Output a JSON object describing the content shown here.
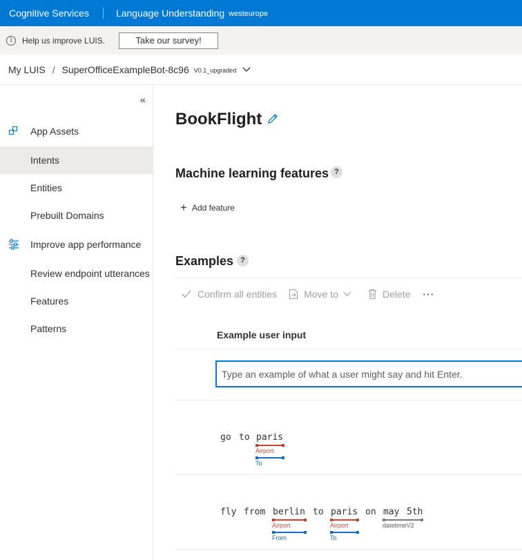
{
  "topbar": {
    "brand": "Cognitive Services",
    "product": "Language Understanding",
    "region": "westeurope"
  },
  "survey": {
    "message": "Help us improve LUIS.",
    "button": "Take our survey!"
  },
  "breadcrumb": {
    "root": "My LUIS",
    "app": "SuperOfficeExampleBot-8c96",
    "version": "V0.1_upgraded"
  },
  "sidebar": {
    "items": [
      {
        "label": "App Assets",
        "icon": "app-assets-icon"
      },
      {
        "label": "Intents",
        "active": true
      },
      {
        "label": "Entities"
      },
      {
        "label": "Prebuilt Domains"
      },
      {
        "label": "Improve app performance",
        "icon": "sliders-icon"
      },
      {
        "label": "Review endpoint utterances"
      },
      {
        "label": "Features"
      },
      {
        "label": "Patterns"
      }
    ]
  },
  "intent": {
    "title": "BookFlight"
  },
  "features": {
    "heading": "Machine learning features",
    "add_label": "Add feature"
  },
  "examples": {
    "heading": "Examples",
    "toolbar": {
      "confirm": "Confirm all entities",
      "move": "Move to",
      "delete": "Delete",
      "more": "···"
    },
    "column_header": "Example user input",
    "input_placeholder": "Type an example of what a user might say and hit Enter.",
    "utterances": [
      {
        "tokens": [
          "go",
          "to",
          "paris"
        ],
        "entities": [
          {
            "token": "paris",
            "label": "Airport",
            "color": "#c8432e"
          },
          {
            "token": "paris",
            "label": "To",
            "color": "#0f6ec1"
          }
        ]
      },
      {
        "tokens": [
          "fly",
          "from",
          "berlin",
          "to",
          "paris",
          "on",
          "may",
          "5th"
        ],
        "entities": [
          {
            "token": "berlin",
            "label": "Airport",
            "color": "#c8432e"
          },
          {
            "token": "berlin",
            "label": "From",
            "color": "#0f6ec1"
          },
          {
            "token": "paris",
            "label": "Airport",
            "color": "#c8432e"
          },
          {
            "token": "paris",
            "label": "To",
            "color": "#0f6ec1"
          },
          {
            "token": "may 5th",
            "label": "datetimeV2",
            "color": "#7a7a7a"
          }
        ]
      }
    ]
  }
}
